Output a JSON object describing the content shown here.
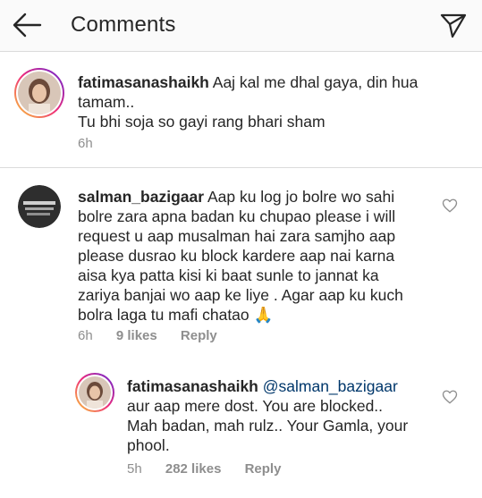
{
  "header": {
    "title": "Comments"
  },
  "caption": {
    "username": "fatimasanashaikh",
    "text_line1": "Aaj kal me dhal gaya, din hua",
    "text_line2": "tamam..",
    "text_line3": "Tu bhi soja so gayi rang bhari sham",
    "time": "6h"
  },
  "comment": {
    "username": "salman_bazigaar",
    "lines": [
      "Aap ku log jo bolre wo sahi",
      "bolre zara apna badan ku chupao please i will",
      "request u aap musalman hai zara samjho aap",
      "please dusrao ku block kardere aap nai karna",
      "aisa kya patta kisi ki baat sunle to jannat ka",
      "zariya banjai wo aap ke liye . Agar aap ku kuch",
      "bolra laga tu mafi chatao 🙏"
    ],
    "time": "6h",
    "likes": "9 likes",
    "reply_label": "Reply"
  },
  "reply": {
    "username": "fatimasanashaikh",
    "mention": "@salman_bazigaar",
    "lines": [
      "aur aap mere dost.  You are blocked..",
      "Mah badan, mah rulz.. Your Gamla, your",
      "phool."
    ],
    "time": "5h",
    "likes": "282 likes",
    "reply_label": "Reply"
  },
  "icons": {
    "back": "arrow-left-icon",
    "send": "paper-plane-icon",
    "like": "heart-outline-icon"
  }
}
